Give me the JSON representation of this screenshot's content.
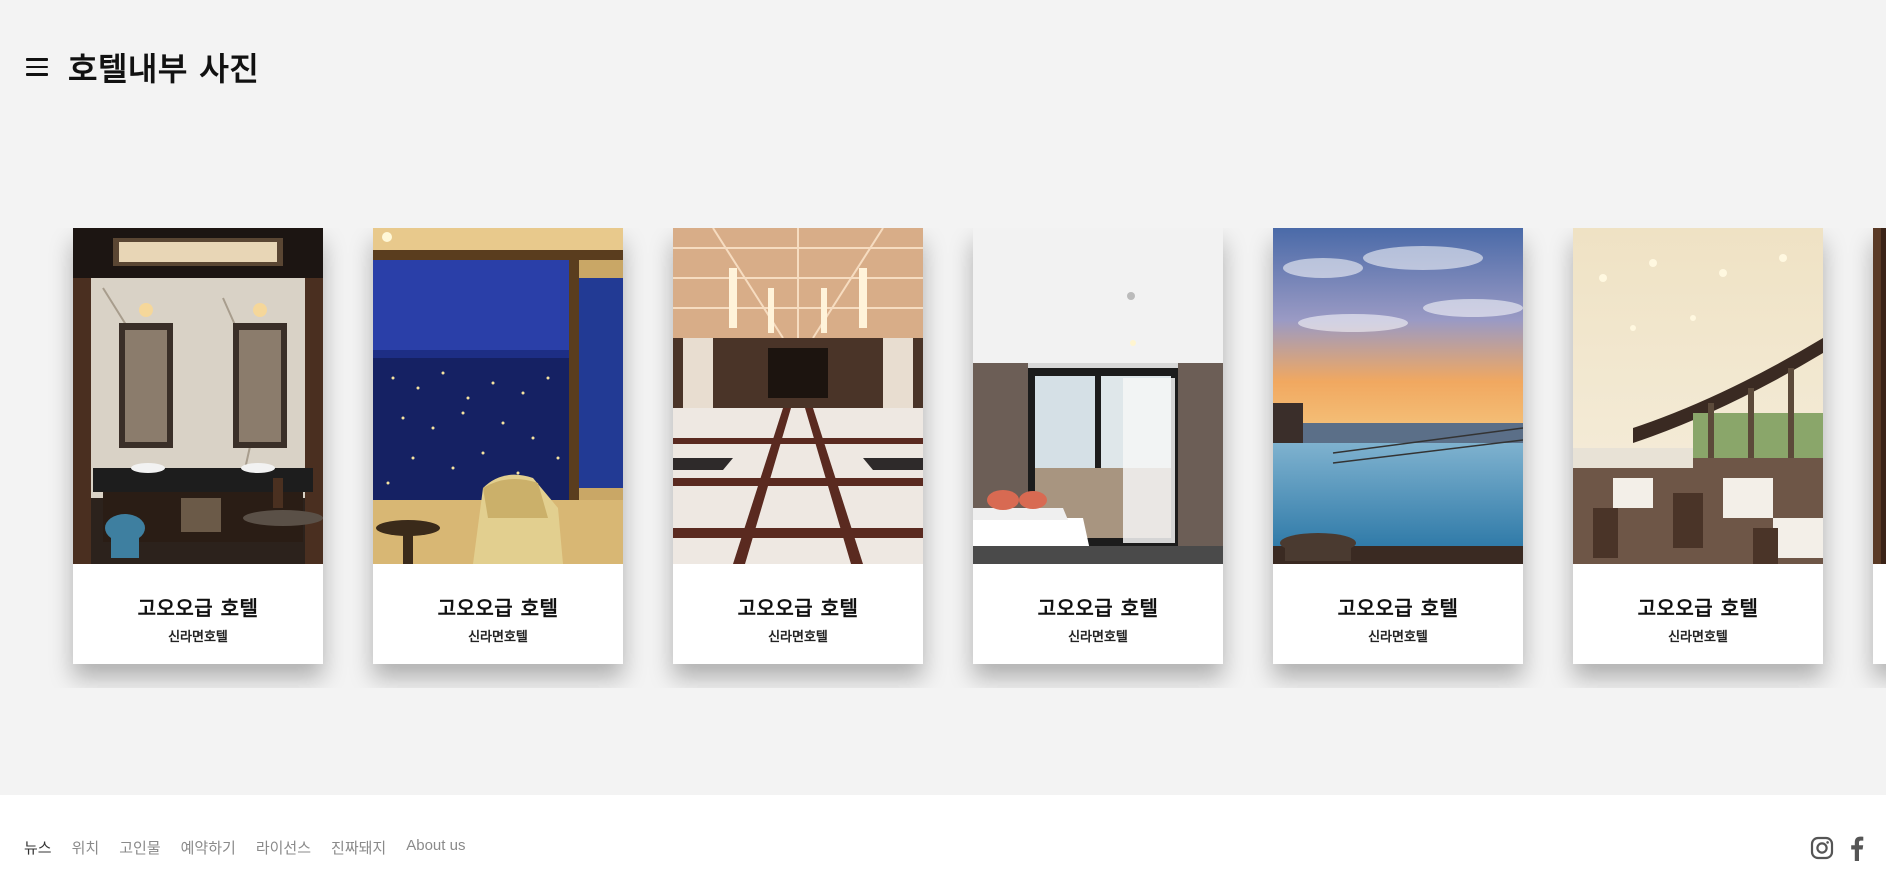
{
  "header": {
    "title": "호텔내부 사진"
  },
  "cards": [
    {
      "title": "고오오급 호텔",
      "subtitle": "신라면호텔",
      "image": "bathroom"
    },
    {
      "title": "고오오급 호텔",
      "subtitle": "신라면호텔",
      "image": "night-city-view"
    },
    {
      "title": "고오오급 호텔",
      "subtitle": "신라면호텔",
      "image": "lobby"
    },
    {
      "title": "고오오급 호텔",
      "subtitle": "신라면호텔",
      "image": "bedroom-balcony"
    },
    {
      "title": "고오오급 호텔",
      "subtitle": "신라면호텔",
      "image": "rooftop-pool-sunset"
    },
    {
      "title": "고오오급 호텔",
      "subtitle": "신라면호텔",
      "image": "restaurant"
    }
  ],
  "footer": {
    "links": [
      "뉴스",
      "위치",
      "고인물",
      "예약하기",
      "라이선스",
      "진짜돼지",
      "About us"
    ],
    "social": [
      "instagram-icon",
      "facebook-icon"
    ]
  },
  "colors": {
    "background": "#f3f3f3",
    "card": "#ffffff",
    "footer": "#ffffff",
    "link": "#8a8a8a",
    "title": "#111111"
  }
}
